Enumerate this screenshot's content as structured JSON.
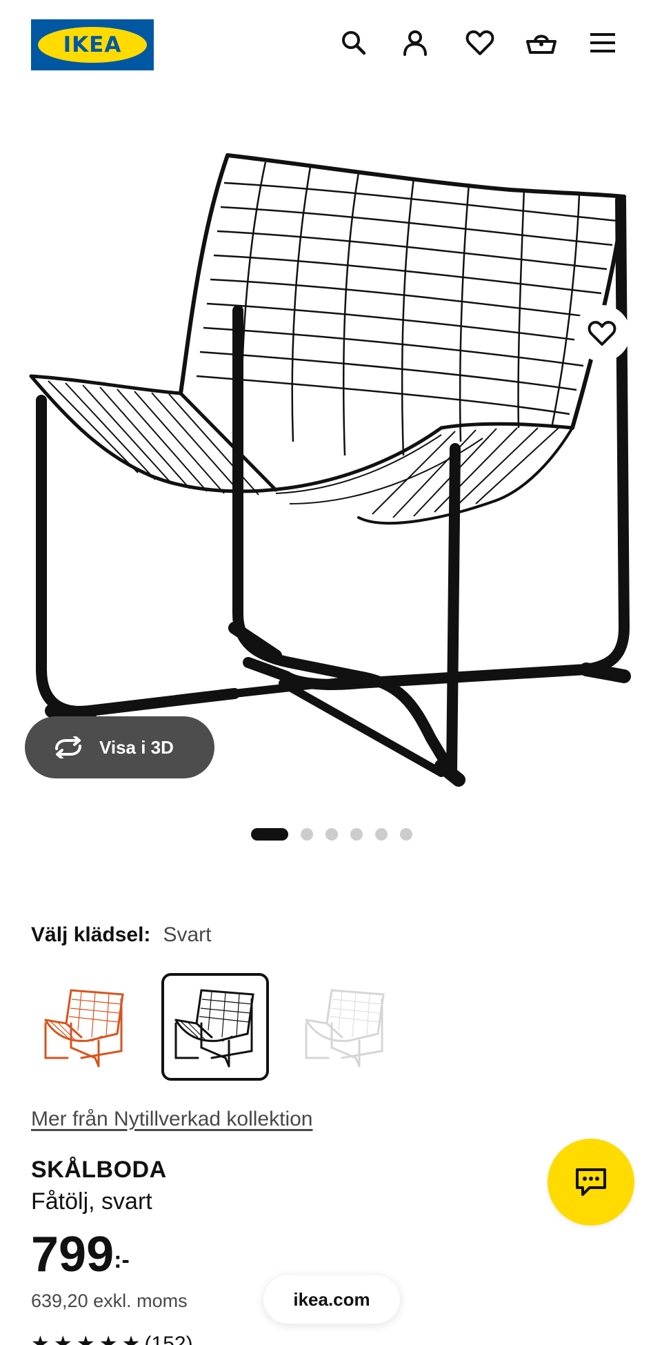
{
  "header": {
    "logo_text": "IKEA",
    "icons": [
      "search-icon",
      "account-icon",
      "heart-icon",
      "basket-icon",
      "menu-icon"
    ]
  },
  "gallery": {
    "view3d_label": "Visa i 3D",
    "slide_count": 6,
    "active_slide": 1
  },
  "cover": {
    "label": "Välj klädsel:",
    "value": "Svart",
    "options": [
      "orange",
      "black",
      "white"
    ],
    "selected_index": 1
  },
  "collection_link": "Mer från Nytillverkad kollektion",
  "product": {
    "name": "SKÅLBODA",
    "description": "Fåtölj, svart",
    "price": "799",
    "price_suffix": ":-",
    "price_ex_vat": "639,20 exkl. moms",
    "rating_count": "(152)",
    "rating_stars": 5
  },
  "browser": {
    "domain": "ikea.com"
  },
  "colors": {
    "brand_blue": "#0058a3",
    "brand_yellow": "#ffdb00",
    "chair_orange": "#d9531e"
  }
}
